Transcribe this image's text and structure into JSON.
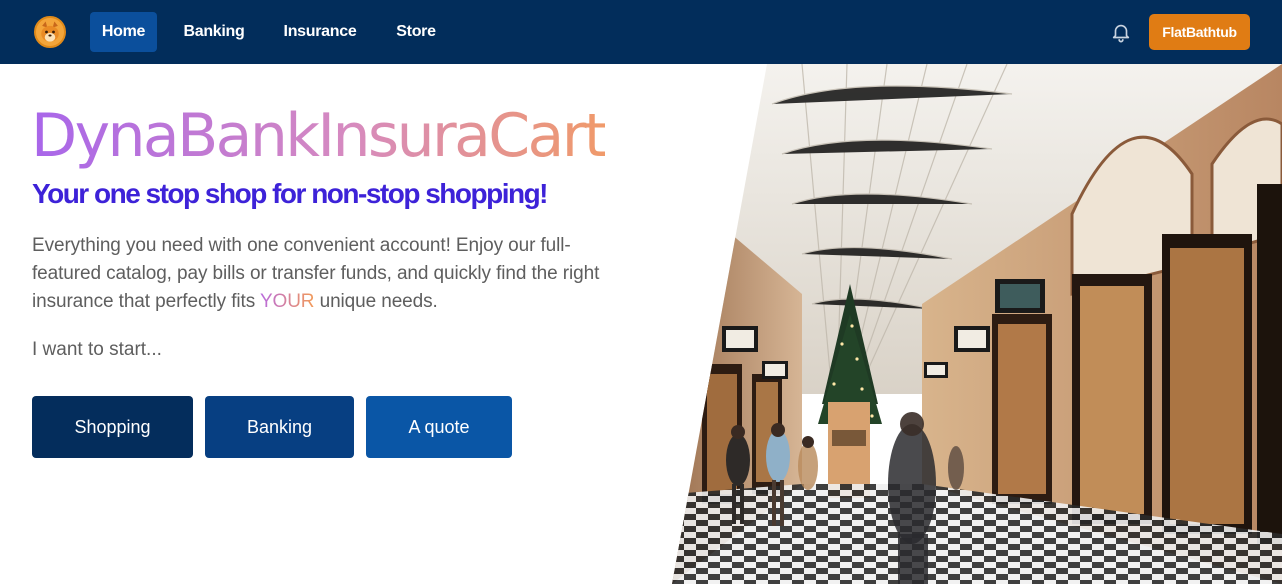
{
  "nav": {
    "links": [
      {
        "label": "Home",
        "active": true
      },
      {
        "label": "Banking",
        "active": false
      },
      {
        "label": "Insurance",
        "active": false
      },
      {
        "label": "Store",
        "active": false
      }
    ],
    "user_label": "FlatBathtub",
    "logo_icon": "shiba-dog-logo-icon",
    "bell_icon": "bell-icon"
  },
  "hero": {
    "brand": "DynaBankInsuraCart",
    "tagline": "Your one stop shop for non-stop shopping!",
    "blurb_before": "Everything you need with one convenient account! Enjoy our full-featured catalog, pay bills or transfer funds, and quickly find the right insurance that perfectly fits ",
    "blurb_highlight": "YOUR",
    "blurb_after": " unique needs.",
    "start_prompt": "I want to start...",
    "buttons": [
      {
        "label": "Shopping"
      },
      {
        "label": "Banking"
      },
      {
        "label": "A quote"
      }
    ]
  },
  "colors": {
    "nav_bg": "#022d5b",
    "nav_active": "#0b4f9c",
    "user_button": "#e07c14",
    "tagline": "#3d22d8",
    "cta_1": "#042d5c",
    "cta_2": "#073f82",
    "cta_3": "#0a56a6"
  }
}
